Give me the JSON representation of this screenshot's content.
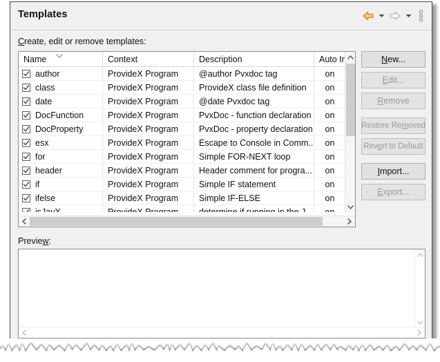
{
  "dialog": {
    "title": "Templates",
    "instruction": "Create, edit or remove templates:",
    "instruction_mnemonic": "C",
    "instruction_rest": "reate, edit or remove templates:"
  },
  "titlebar_tools": [
    {
      "name": "back-arrow-icon",
      "label": "Back",
      "state": "enabled"
    },
    {
      "name": "back-dropdown-icon",
      "label": "Back history",
      "state": "enabled"
    },
    {
      "name": "forward-arrow-icon",
      "label": "Forward",
      "state": "disabled"
    },
    {
      "name": "forward-dropdown-icon",
      "label": "Forward history",
      "state": "enabled"
    },
    {
      "name": "view-menu-icon",
      "label": "View Menu",
      "state": "enabled"
    }
  ],
  "table": {
    "columns": [
      {
        "key": "name",
        "label": "Name",
        "sorted": true,
        "sort_dir": "down"
      },
      {
        "key": "context",
        "label": "Context",
        "sorted": false
      },
      {
        "key": "description",
        "label": "Description",
        "sorted": false
      },
      {
        "key": "auto_insert",
        "label": "Auto Ins",
        "sorted": false,
        "truncated": true
      }
    ],
    "rows": [
      {
        "checked": true,
        "name": "author",
        "context": "ProvideX Program",
        "description": "@author Pvxdoc tag",
        "auto_insert": "on"
      },
      {
        "checked": true,
        "name": "class",
        "context": "ProvideX Program",
        "description": "ProvideX class file definition",
        "auto_insert": "on"
      },
      {
        "checked": true,
        "name": "date",
        "context": "ProvideX Program",
        "description": "@date Pvxdoc tag",
        "auto_insert": "on"
      },
      {
        "checked": true,
        "name": "DocFunction",
        "context": "ProvideX Program",
        "description": "PvxDoc - function declaration",
        "auto_insert": "on"
      },
      {
        "checked": true,
        "name": "DocProperty",
        "context": "ProvideX Program",
        "description": "PvxDoc - property declaration",
        "auto_insert": "on"
      },
      {
        "checked": true,
        "name": "esx",
        "context": "ProvideX Program",
        "description": "Escape to Console in Comm...",
        "auto_insert": "on"
      },
      {
        "checked": true,
        "name": "for",
        "context": "ProvideX Program",
        "description": "Simple FOR-NEXT loop",
        "auto_insert": "on"
      },
      {
        "checked": true,
        "name": "header",
        "context": "ProvideX Program",
        "description": "Header comment for progra...",
        "auto_insert": "on"
      },
      {
        "checked": true,
        "name": "if",
        "context": "ProvideX Program",
        "description": "Simple IF statement",
        "auto_insert": "on"
      },
      {
        "checked": true,
        "name": "ifelse",
        "context": "ProvideX Program",
        "description": "Simple IF-ELSE",
        "auto_insert": "on"
      },
      {
        "checked": true,
        "name": "isJavX",
        "context": "ProvideX Program",
        "description": "determine if running in the J...",
        "auto_insert": "on"
      }
    ]
  },
  "side_buttons": [
    {
      "label": "New...",
      "mnemonic_index": 0,
      "state": "enabled",
      "group": 1
    },
    {
      "label": "Edit...",
      "mnemonic_index": 0,
      "state": "disabled",
      "group": 1
    },
    {
      "label": "Remove",
      "mnemonic_index": 0,
      "state": "disabled",
      "group": 1
    },
    {
      "label": "Restore Removed",
      "mnemonic_index": 10,
      "state": "disabled",
      "group": 2
    },
    {
      "label": "Revert to Default",
      "mnemonic_index": 3,
      "state": "disabled",
      "group": 2
    },
    {
      "label": "Import...",
      "mnemonic_index": 0,
      "state": "enabled",
      "group": 3
    },
    {
      "label": "Export...",
      "mnemonic_index": 0,
      "state": "disabled",
      "group": 3
    }
  ],
  "preview": {
    "label": "Preview:",
    "label_mnemonic": "w",
    "content": ""
  },
  "colors": {
    "dialog_background": "#f0f0f0",
    "content_background": "#ffffff",
    "border": "#8c8c8c",
    "frame_border": "#4a4a4a",
    "button_face": "#e1e1e1",
    "button_border": "#adadad",
    "disabled_text": "#9a9a9a",
    "text": "#101010",
    "scrollbar_track": "#f5f5f5",
    "scrollbar_thumb": "#cdcdcd",
    "back_arrow": "#e8a317",
    "forward_arrow": "#b8b8b8"
  }
}
